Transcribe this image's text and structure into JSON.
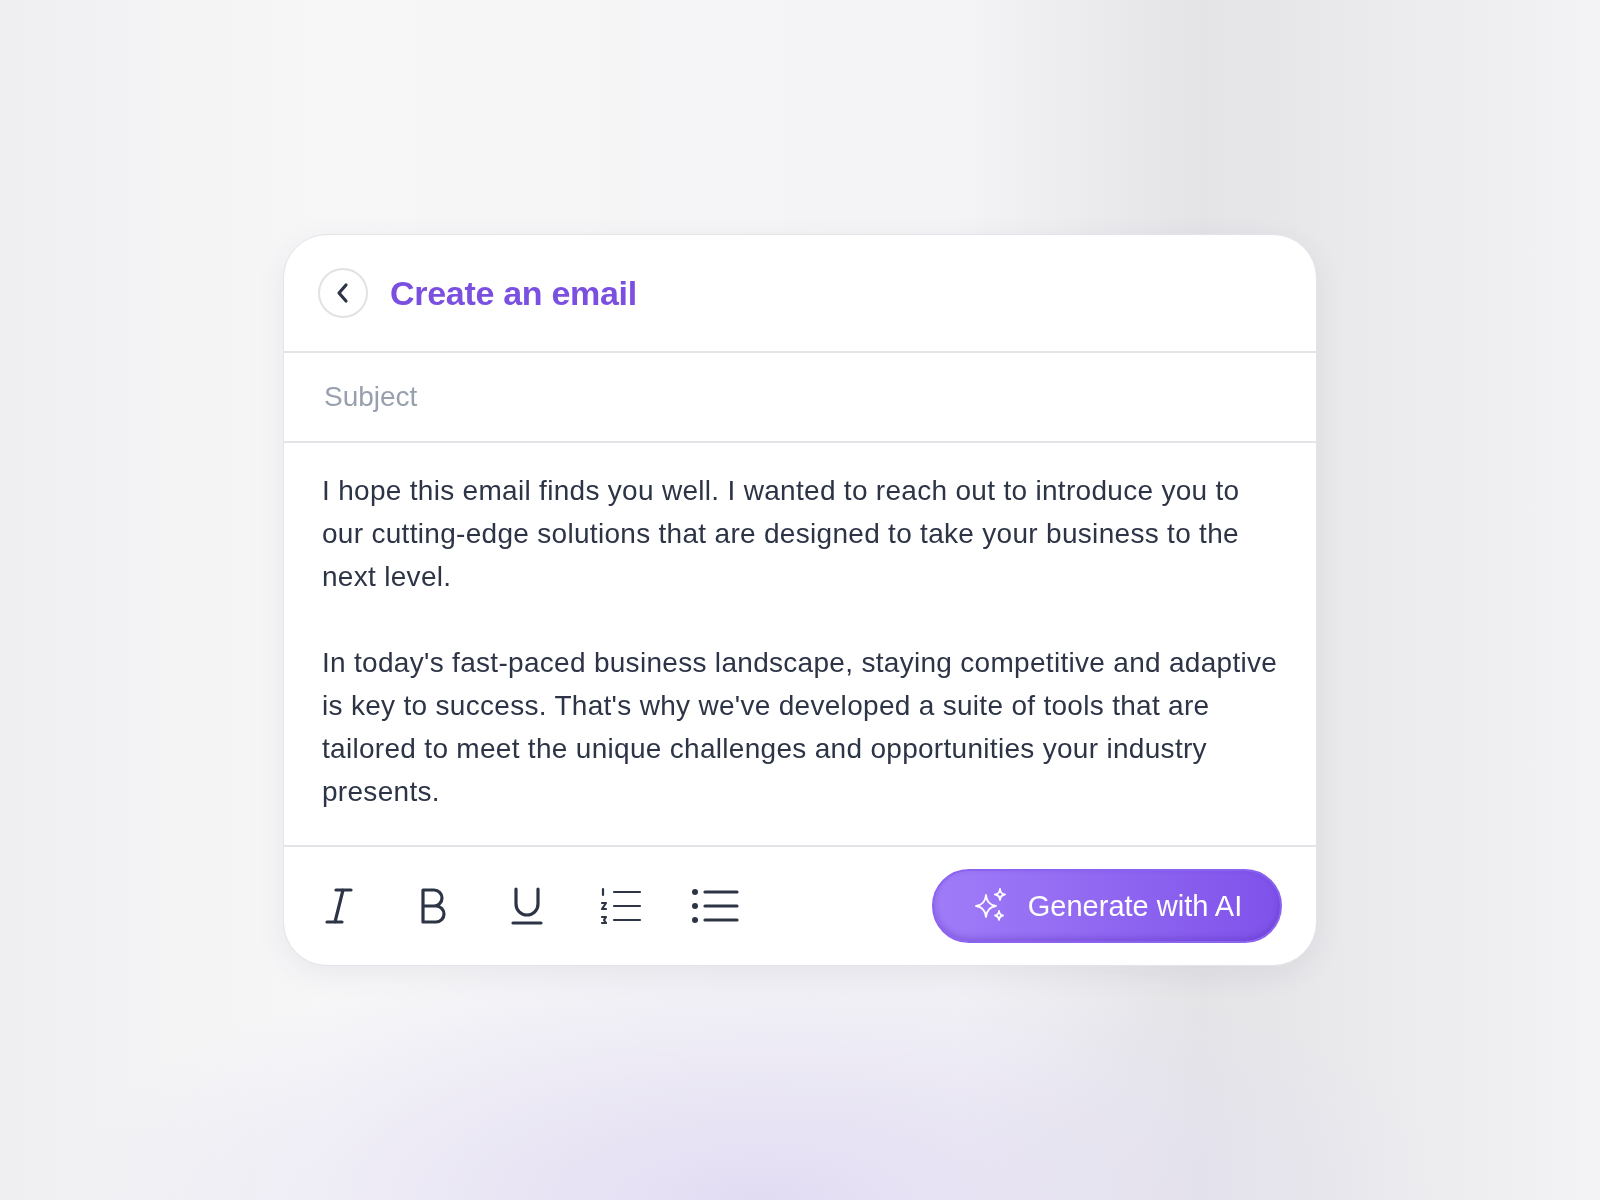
{
  "header": {
    "back_button": {
      "kind": "back"
    },
    "title": "Create an email"
  },
  "subject": {
    "placeholder": "Subject"
  },
  "body": {
    "paragraphs": [
      "I hope this email finds you well. I wanted to reach out to introduce you to our cutting-edge solutions that are designed to take your business to the next level.",
      "In today's fast-paced business landscape, staying competitive and adaptive is key to success. That's why we've developed a suite of tools that are tailored to meet the unique challenges and opportunities your industry presents."
    ]
  },
  "toolbar": {
    "tools": [
      {
        "kind": "italic"
      },
      {
        "kind": "bold"
      },
      {
        "kind": "underline"
      },
      {
        "kind": "numbered-list"
      },
      {
        "kind": "bullet-list"
      }
    ],
    "generate_button": {
      "label": "Generate with AI"
    }
  }
}
